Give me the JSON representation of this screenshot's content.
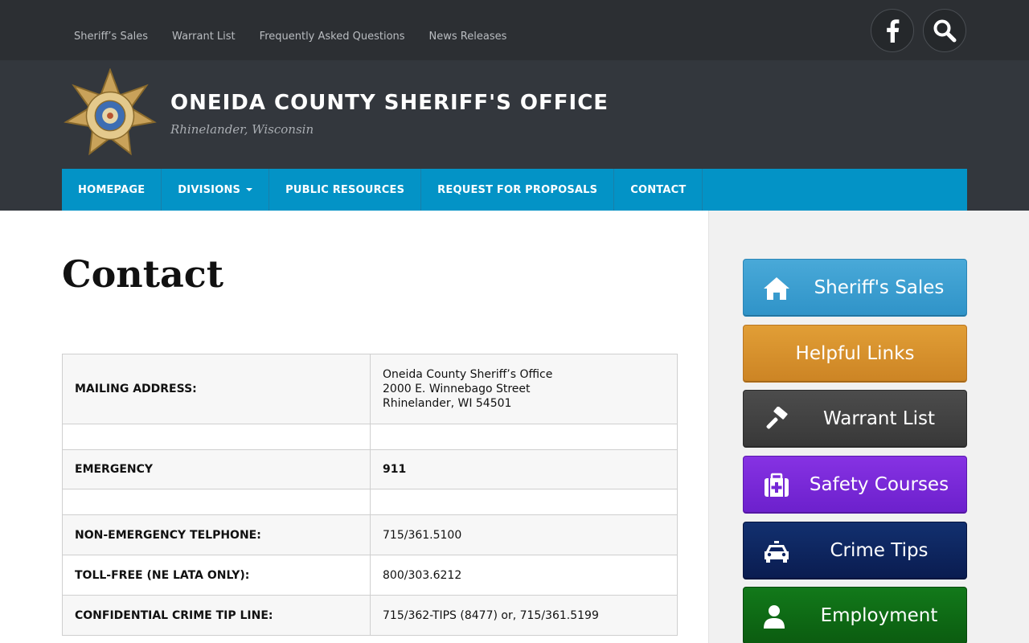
{
  "topbar": {
    "links": [
      "Sheriff’s Sales",
      "Warrant List",
      "Frequently Asked Questions",
      "News Releases"
    ]
  },
  "icons": {
    "facebook": "facebook-icon",
    "search": "search-icon",
    "badge": "sheriff-badge-logo",
    "home": "home-icon",
    "gavel": "gavel-icon",
    "medkit": "medkit-icon",
    "car": "car-icon",
    "user": "user-icon"
  },
  "header": {
    "title": "ONEIDA COUNTY SHERIFF'S OFFICE",
    "subtitle": "Rhinelander, Wisconsin"
  },
  "mainnav": [
    "HOMEPAGE",
    "DIVISIONS",
    "PUBLIC RESOURCES",
    "REQUEST FOR PROPOSALS",
    "CONTACT"
  ],
  "page": {
    "title": "Contact"
  },
  "contact_table": {
    "mailing_label": "MAILING ADDRESS:",
    "mailing_line1": "Oneida County Sheriff’s Office",
    "mailing_line2": "2000 E. Winnebago Street",
    "mailing_line3": "Rhinelander, WI 54501",
    "emergency_label": "EMERGENCY",
    "emergency_value": "911",
    "nonemergency_label": "NON-EMERGENCY TELPHONE:",
    "nonemergency_value": "715/361.5100",
    "tollfree_label": "TOLL-FREE (NE LATA ONLY):",
    "tollfree_value": "800/303.6212",
    "tipline_label": "CONFIDENTIAL CRIME TIP LINE:",
    "tipline_value": "715/362-TIPS (8477) or, 715/361.5199"
  },
  "sidebar": {
    "buttons": [
      {
        "label": "Sheriff's Sales",
        "color": "#3c9fd0"
      },
      {
        "label": "Helpful Links",
        "color": "#d8922c"
      },
      {
        "label": "Warrant List",
        "color": "#434343"
      },
      {
        "label": "Safety Courses",
        "color": "#7a2ad8"
      },
      {
        "label": "Crime Tips",
        "color": "#0d2460"
      },
      {
        "label": "Employment",
        "color": "#0e6d12"
      }
    ]
  },
  "colors": {
    "topbar": "#2c2f33",
    "header": "#33373d",
    "nav": "#0393c6"
  }
}
